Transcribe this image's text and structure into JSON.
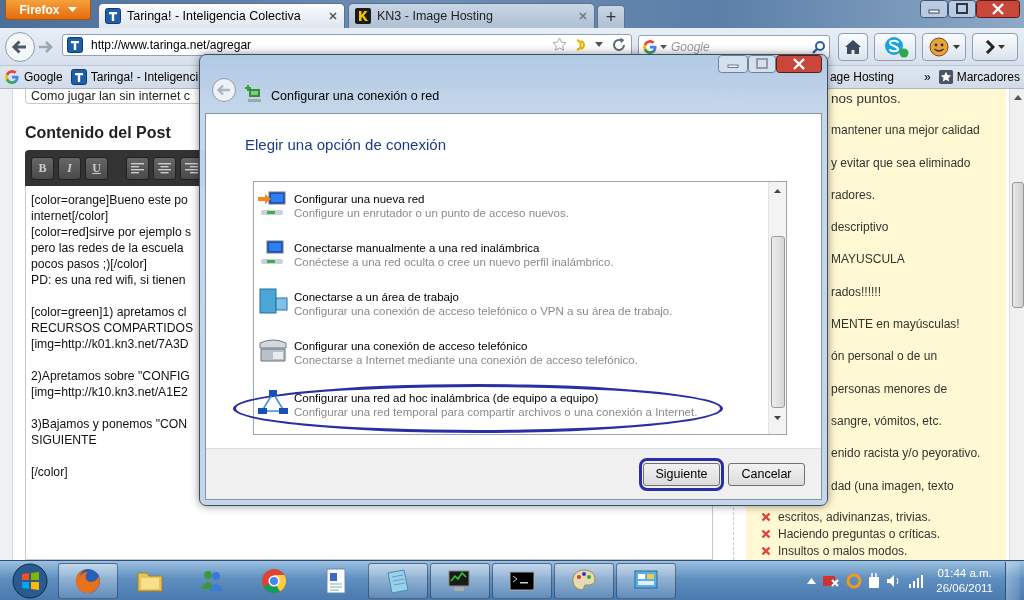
{
  "browser": {
    "firefox_button": "Firefox",
    "tabs": [
      {
        "label": "Taringa! - Inteligencia Colectiva",
        "selected": true
      },
      {
        "label": "KN3 - Image Hosting",
        "selected": false
      }
    ],
    "new_tab": "+",
    "address": "http://www.taringa.net/agregar",
    "search": {
      "placeholder": "Google"
    },
    "bookmarks": [
      {
        "label": "Google",
        "kind": "google"
      },
      {
        "label": "Taringa! - Inteligenci",
        "kind": "taringa"
      }
    ],
    "bookmarks_right": "age Hosting",
    "bookmarks_more": "»",
    "bookmarks_menu": "Marcadores"
  },
  "editor": {
    "title_value": "Como jugar lan sin internet c",
    "heading": "Contenido del Post",
    "toolbar": [
      "B",
      "I",
      "U"
    ],
    "paragraphs": [
      [
        "[color=orange]Bueno este po",
        "internet[/color]",
        "[color=red]sirve por ejemplo s",
        "pero las redes de la escuela",
        "pocos pasos ;)[/color]",
        "PD: es una red wifi, si tienen"
      ],
      [
        "[color=green]1) apretamos cl",
        "RECURSOS COMPARTIDOS",
        "[img=http://k01.kn3.net/7A3D"
      ],
      [
        "2)Apretamos sobre \"CONFIG",
        "[img=http://k10.kn3.net/A1E2"
      ],
      [
        "3)Bajamos y ponemos \"CON",
        "SIGUIENTE"
      ],
      [
        "[/color]"
      ]
    ]
  },
  "rules": {
    "items": [
      {
        "text": "nos puntos.",
        "kind": "heading"
      },
      {
        "text": "mantener una mejor calidad",
        "kind": "plain"
      },
      {
        "text": "y evitar que sea eliminado",
        "kind": "plain"
      },
      {
        "text": "radores.",
        "kind": "plain"
      },
      {
        "text": "descriptivo",
        "kind": "plain"
      },
      {
        "text": "MAYUSCULA",
        "kind": "plain"
      },
      {
        "text": "rados!!!!!!",
        "kind": "plain"
      },
      {
        "text": "MENTE en mayúsculas!",
        "kind": "plain"
      },
      {
        "text": "ón personal o de un",
        "kind": "plain"
      },
      {
        "text": "personas menores de",
        "kind": "plain"
      },
      {
        "text": "sangre, vómitos, etc.",
        "kind": "plain"
      },
      {
        "text": "enido racista y/o peyorativo.",
        "kind": "plain"
      },
      {
        "text": "dad (una imagen, texto",
        "kind": "plain"
      },
      {
        "text": "escritos, adivinanzas, trivias.",
        "kind": "forbidden"
      },
      {
        "text": "Haciendo preguntas o críticas.",
        "kind": "forbidden"
      },
      {
        "text": "Insultos o malos modos.",
        "kind": "forbidden"
      }
    ]
  },
  "dialog": {
    "title": "Configurar una conexión o red",
    "heading": "Elegir una opción de conexión",
    "options": [
      {
        "kind": "new-network",
        "title": "Configurar una nueva red",
        "description": "Configure un enrutador o un punto de acceso nuevos.",
        "circled": false
      },
      {
        "kind": "wireless",
        "title": "Conectarse manualmente a una red inalámbrica",
        "description": "Conéctese a una red oculta o cree un nuevo perfil inalámbrico.",
        "circled": false
      },
      {
        "kind": "workplace",
        "title": "Conectarse a un área de trabajo",
        "description": "Configurar una conexión de acceso telefónico o VPN a su área de trabajo.",
        "circled": false
      },
      {
        "kind": "dialup",
        "title": "Configurar una conexión de acceso telefónico",
        "description": "Conectarse a Internet mediante una conexión de acceso telefónico.",
        "circled": false
      },
      {
        "kind": "adhoc",
        "title": "Configurar una red ad hoc inalámbrica (de equipo a equipo)",
        "description": "Configurar una red temporal para compartir archivos o una conexión a Internet.",
        "circled": true
      }
    ],
    "buttons": [
      {
        "label": "Siguiente",
        "circled": true
      },
      {
        "label": "Cancelar",
        "circled": false
      }
    ]
  },
  "taskbar": {
    "time": "01:44 a.m.",
    "date": "26/06/2011"
  }
}
